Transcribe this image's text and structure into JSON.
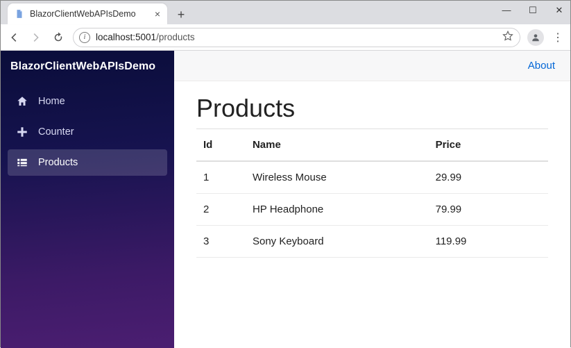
{
  "browser": {
    "tab_title": "BlazorClientWebAPIsDemo",
    "url_host": "localhost:5001",
    "url_path": "/products"
  },
  "brand": "BlazorClientWebAPIsDemo",
  "sidebar": {
    "items": [
      {
        "label": "Home",
        "icon": "home-icon",
        "active": false
      },
      {
        "label": "Counter",
        "icon": "plus-icon",
        "active": false
      },
      {
        "label": "Products",
        "icon": "list-icon",
        "active": true
      }
    ]
  },
  "topbar": {
    "about_label": "About"
  },
  "page": {
    "title": "Products"
  },
  "table": {
    "headers": {
      "id": "Id",
      "name": "Name",
      "price": "Price"
    },
    "rows": [
      {
        "id": "1",
        "name": "Wireless Mouse",
        "price": "29.99"
      },
      {
        "id": "2",
        "name": "HP Headphone",
        "price": "79.99"
      },
      {
        "id": "3",
        "name": "Sony Keyboard",
        "price": "119.99"
      }
    ]
  }
}
